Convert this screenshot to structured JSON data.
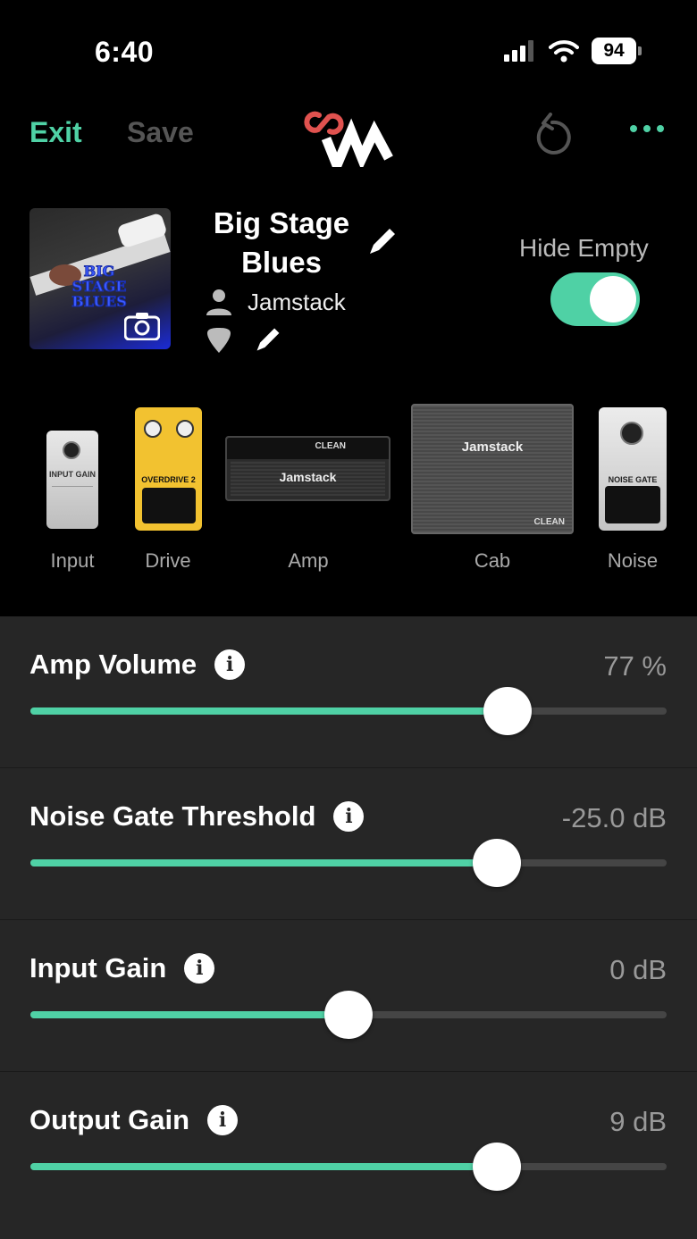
{
  "status_bar": {
    "time": "6:40",
    "battery": "94"
  },
  "header": {
    "exit_label": "Exit",
    "save_label": "Save",
    "icons": [
      "logo-icon",
      "undo-icon",
      "more-icon"
    ]
  },
  "preset": {
    "cover_text": "BIG STAGE BLUES",
    "name": "Big Stage Blues",
    "author": "Jamstack",
    "hide_empty_label": "Hide Empty",
    "hide_empty_on": true
  },
  "chain": [
    {
      "label": "Input",
      "pedal_text": "INPUT GAIN"
    },
    {
      "label": "Drive",
      "pedal_text": "OVERDRIVE 2"
    },
    {
      "label": "Amp",
      "pedal_text": "CLEAN",
      "brand": "Jamstack"
    },
    {
      "label": "Cab",
      "pedal_text": "CLEAN",
      "brand": "Jamstack"
    },
    {
      "label": "Noise",
      "pedal_text": "NOISE GATE"
    }
  ],
  "controls": [
    {
      "label": "Amp Volume",
      "value": "77 %",
      "fraction": 0.75
    },
    {
      "label": "Noise Gate Threshold",
      "value": "-25.0 dB",
      "fraction": 0.733
    },
    {
      "label": "Input Gain",
      "value": "0 dB",
      "fraction": 0.5
    },
    {
      "label": "Output Gain",
      "value": "9 dB",
      "fraction": 0.733
    }
  ],
  "colors": {
    "accent": "#4fd1a5",
    "panel": "#262626",
    "background": "#000000"
  }
}
